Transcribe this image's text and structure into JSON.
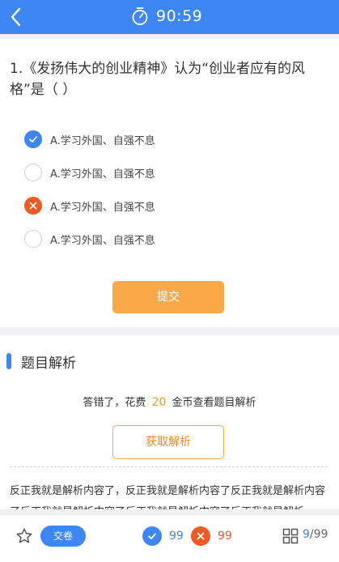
{
  "header": {
    "timer": "90:59",
    "icons": {
      "back": "chevron-left-icon",
      "timer": "stopwatch-icon"
    }
  },
  "question": {
    "text": "1.《发扬伟大的创业精神》认为“创业者应有的风格”是（  ）",
    "options": [
      {
        "label": "A.学习外国、自强不息",
        "state": "correct"
      },
      {
        "label": "A.学习外国、自强不息",
        "state": "unselected"
      },
      {
        "label": "A.学习外国、自强不息",
        "state": "wrong"
      },
      {
        "label": "A.学习外国、自强不息",
        "state": "unselected"
      }
    ],
    "submit_label": "提交"
  },
  "analysis": {
    "title": "题目解析",
    "cost_prefix": "答错了，花费",
    "cost_amount": "20",
    "cost_suffix": "金币查看题目解析",
    "get_button": "获取解析",
    "content": "反正我就是解析内容了，反正我就是解析内容了反正我就是解析内容了反正我就是解析内容了反正我就是解析内容了反正我就是解析"
  },
  "footer": {
    "hand_in_label": "交卷",
    "correct_count": "99",
    "wrong_count": "99",
    "current": "9",
    "separator": "/",
    "total": "99",
    "icons": {
      "favorite": "star-outline-icon",
      "answer_sheet": "grid-icon"
    }
  },
  "colors": {
    "primary": "#3f86f5",
    "wrong": "#f05a22",
    "submit": "#f9a94a",
    "accent": "#f39a1e"
  }
}
